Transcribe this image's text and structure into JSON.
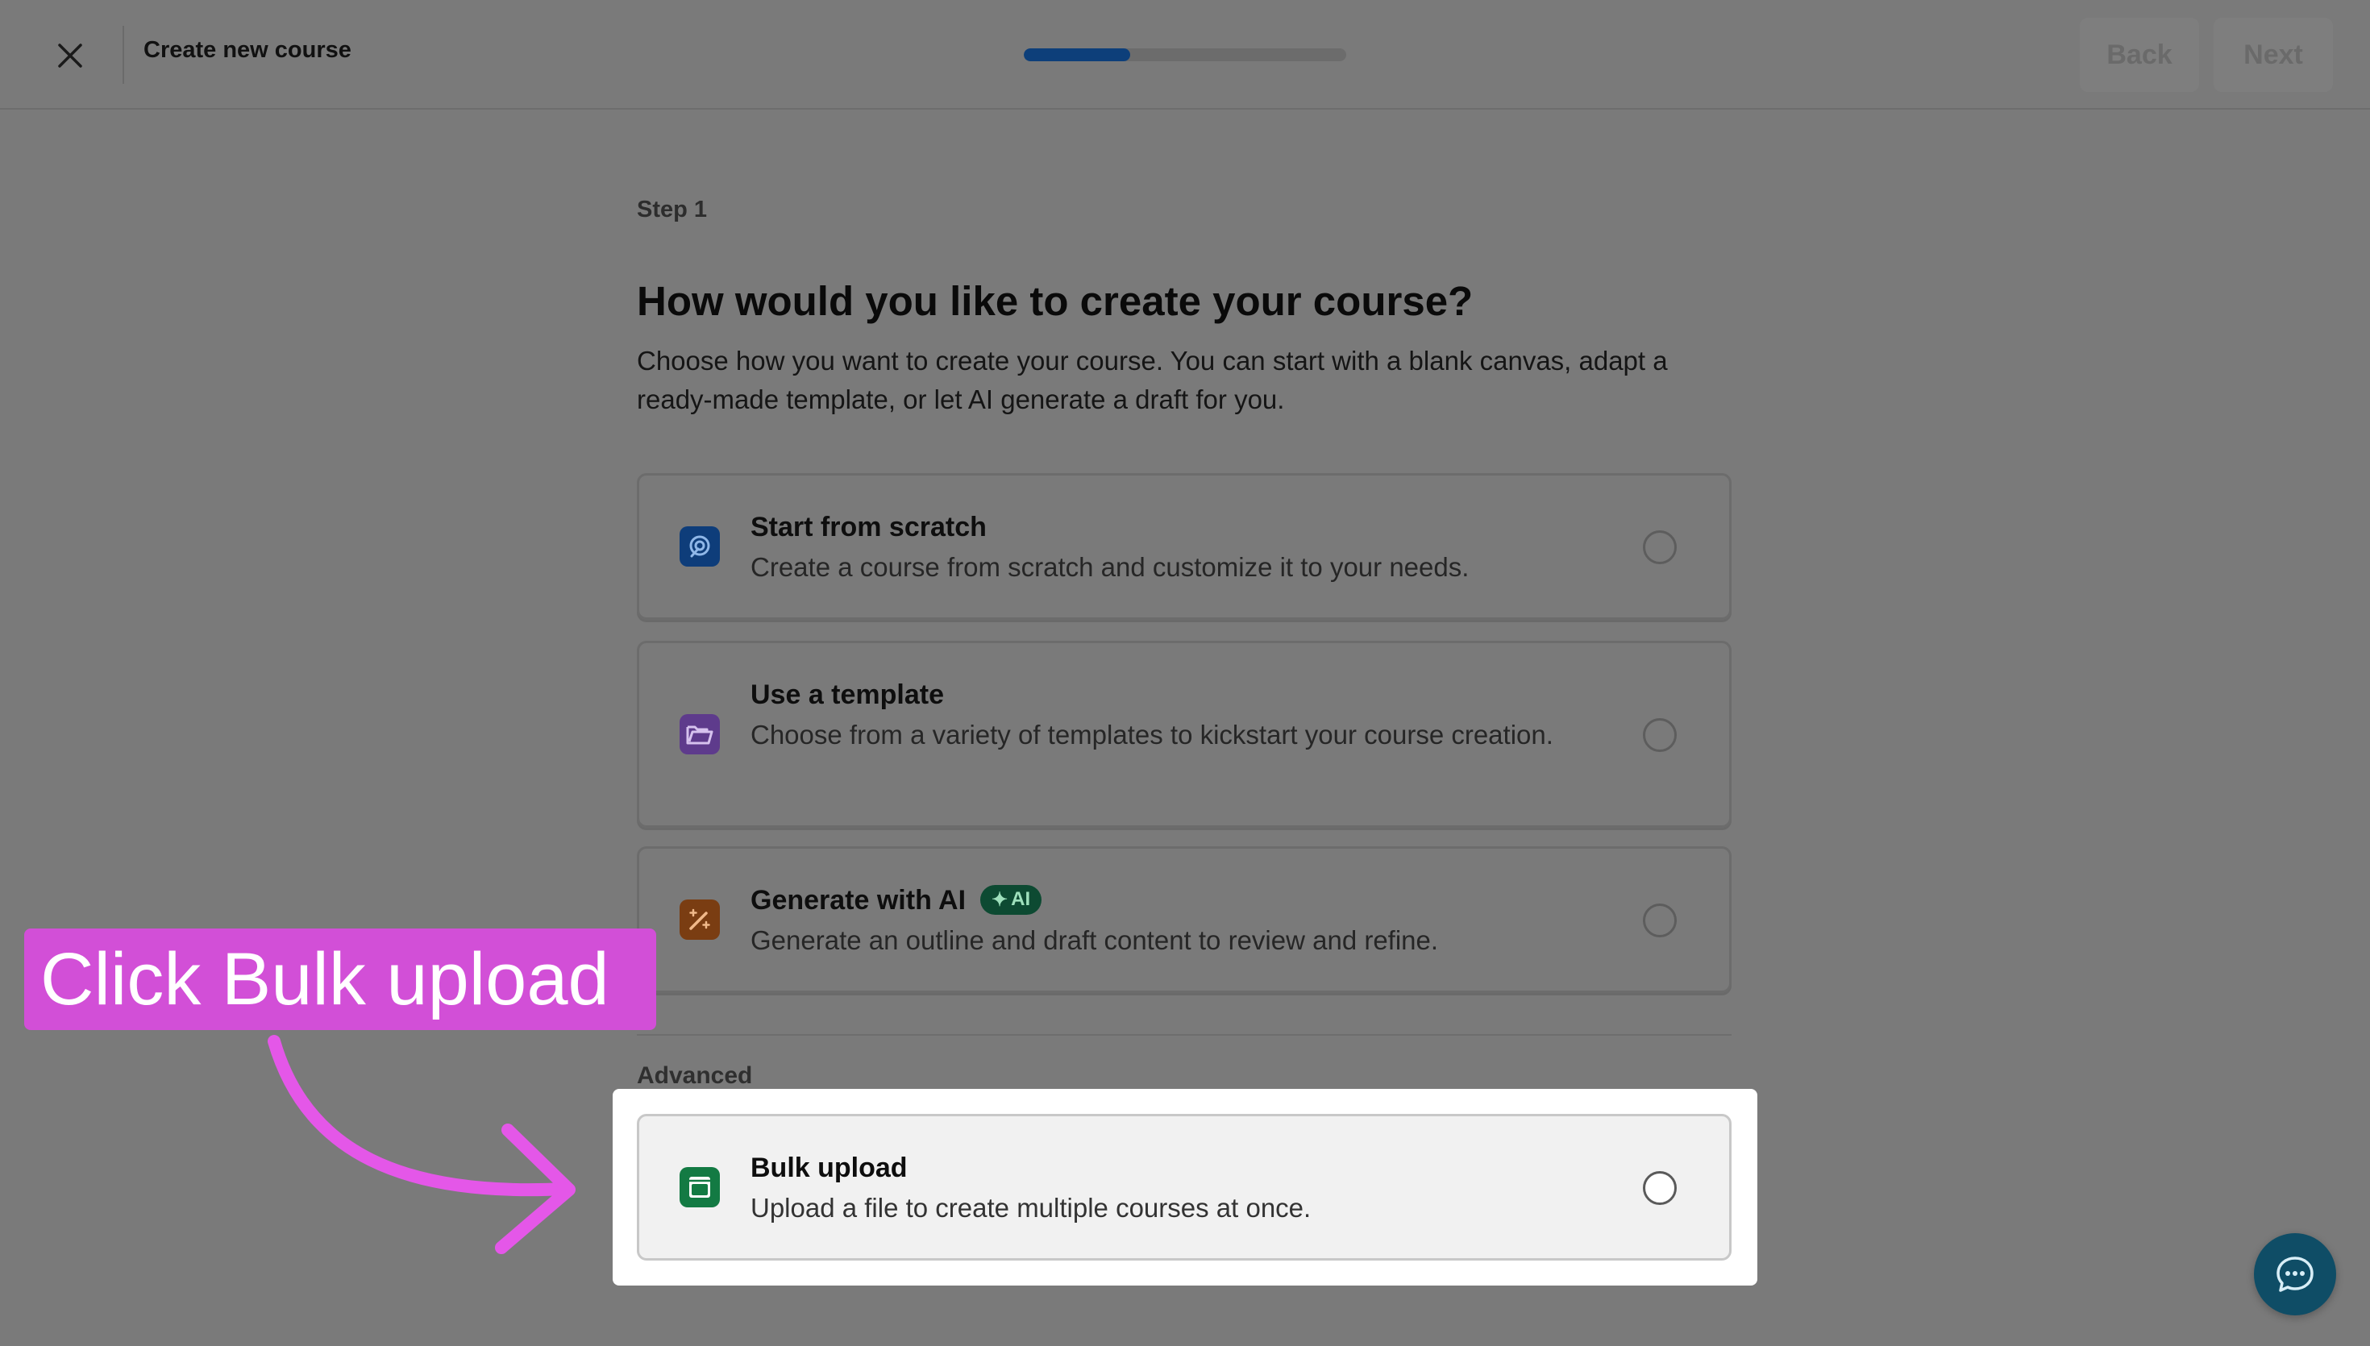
{
  "header": {
    "title": "Create new course",
    "progress_fraction": 0.33,
    "back_label": "Back",
    "next_label": "Next"
  },
  "main": {
    "step_label": "Step 1",
    "heading": "How would you like to create your course?",
    "description": "Choose how you want to create your course. You can start with a blank canvas, adapt a ready-made template, or let AI generate a draft for you.",
    "options": [
      {
        "title": "Start from scratch",
        "description": "Create a course from scratch and customize it to your needs.",
        "icon": "scratch-icon",
        "selected": false
      },
      {
        "title": "Use a template",
        "description": "Choose from a variety of templates to kickstart your course creation.",
        "icon": "folder-icon",
        "selected": false
      },
      {
        "title": "Generate with AI",
        "badge": "AI",
        "description": "Generate an outline and draft content to review and refine.",
        "icon": "magic-wand-icon",
        "selected": false
      }
    ],
    "advanced_label": "Advanced",
    "bulk": {
      "title": "Bulk upload",
      "description": "Upload a file to create multiple courses at once.",
      "icon": "bulk-upload-icon",
      "selected": false
    }
  },
  "annotation": {
    "callout_text": "Click Bulk upload"
  },
  "colors": {
    "accent": "#0d3f7a",
    "callout": "#d24fd7",
    "ai_badge": "#0d4a32",
    "chat": "#0f4d66"
  }
}
